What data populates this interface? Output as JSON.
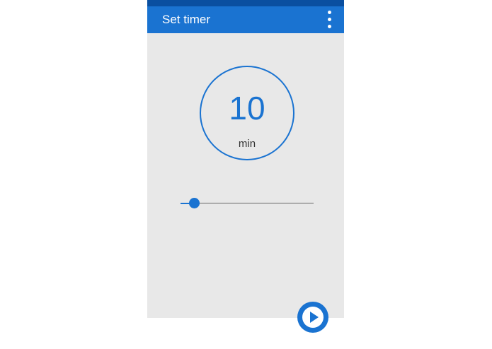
{
  "app_bar": {
    "title": "Set timer",
    "menu_icon": "more-vert-icon"
  },
  "timer": {
    "value": "10",
    "unit": "min"
  },
  "slider": {
    "level": 0.1
  },
  "fab": {
    "icon": "play-icon"
  },
  "colors": {
    "accent": "#1a73d1",
    "status_bar": "#0a4fa0",
    "background": "#e8e8e8"
  }
}
